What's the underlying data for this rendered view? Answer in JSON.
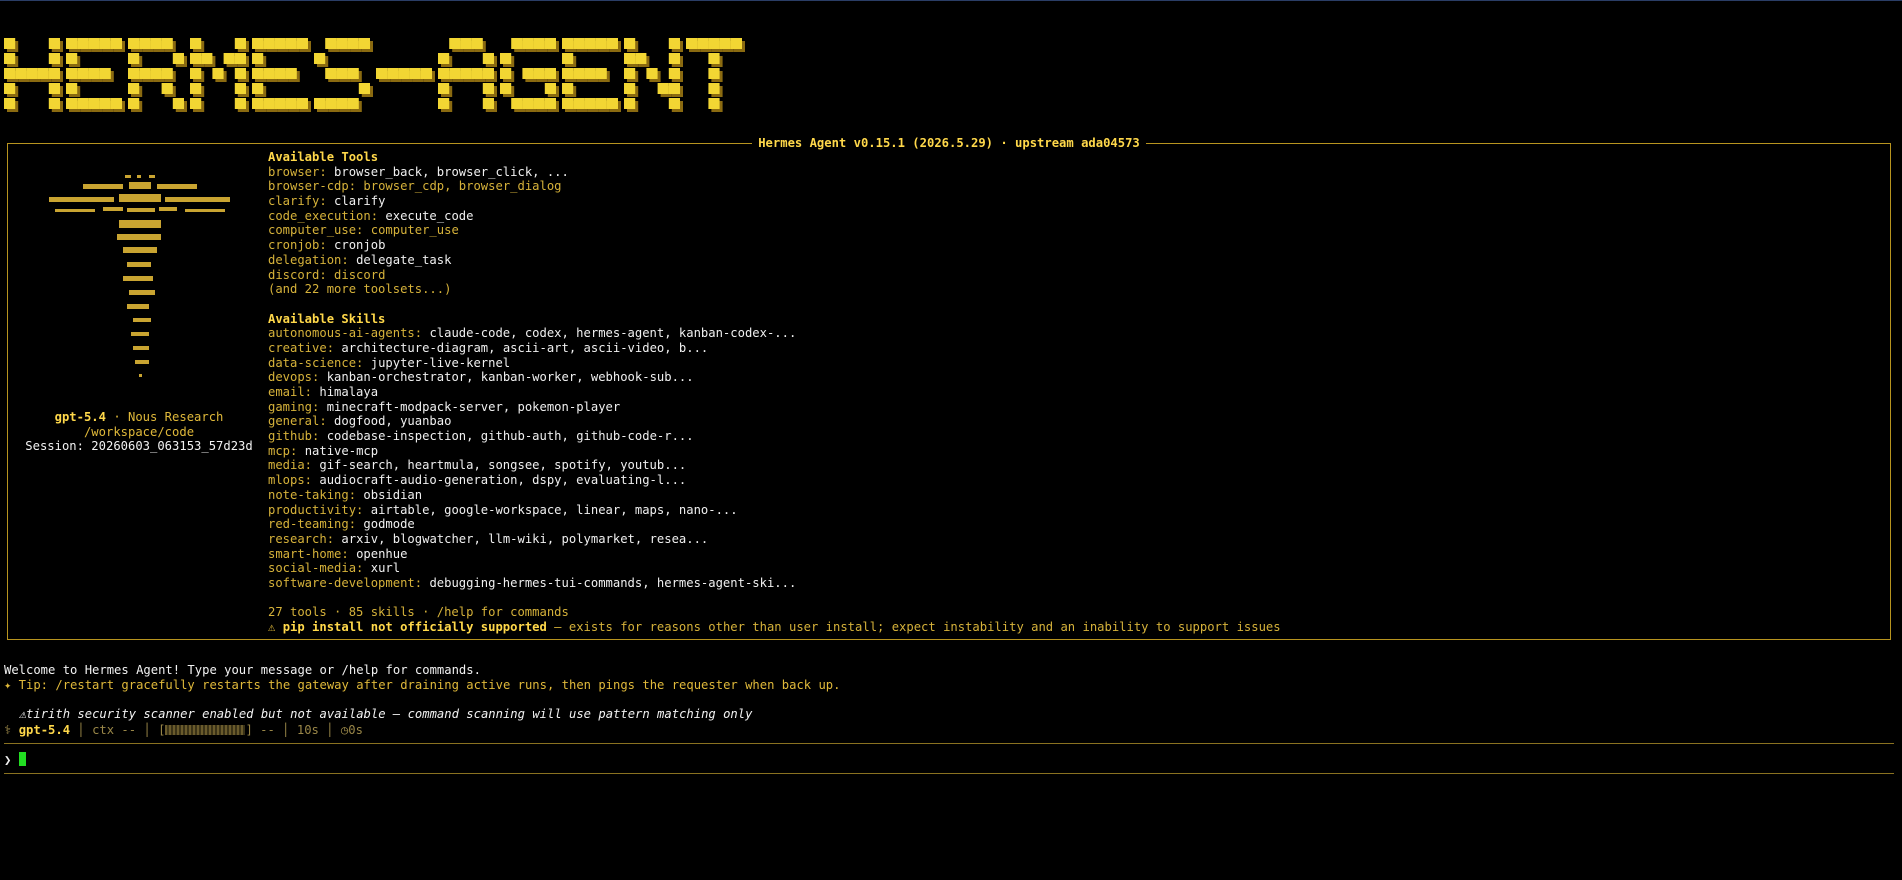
{
  "logo_text": "HERMES-AGENT",
  "banner": {
    "title": "Hermes Agent v0.15.1 (2026.5.29) · upstream ada04573",
    "model": "gpt-5.4",
    "separator": " · ",
    "provider": "Nous Research",
    "cwd": "/workspace/code",
    "session": "Session: 20260603_063153_57d23d"
  },
  "tools": {
    "heading": "Available Tools",
    "items": [
      {
        "key": "browser:",
        "value": "browser_back, browser_click, ..."
      },
      {
        "key": "browser-cdp:",
        "value": "browser_cdp, browser_dialog"
      },
      {
        "key": "clarify:",
        "value": "clarify"
      },
      {
        "key": "code_execution:",
        "value": "execute_code"
      },
      {
        "key": "computer_use:",
        "value": "computer_use"
      },
      {
        "key": "cronjob:",
        "value": "cronjob"
      },
      {
        "key": "delegation:",
        "value": "delegate_task"
      },
      {
        "key": "discord:",
        "value": "discord"
      }
    ],
    "more": "(and 22 more toolsets...)"
  },
  "skills": {
    "heading": "Available Skills",
    "items": [
      {
        "key": "autonomous-ai-agents:",
        "value": "claude-code, codex, hermes-agent, kanban-codex-..."
      },
      {
        "key": "creative:",
        "value": "architecture-diagram, ascii-art, ascii-video, b..."
      },
      {
        "key": "data-science:",
        "value": "jupyter-live-kernel"
      },
      {
        "key": "devops:",
        "value": "kanban-orchestrator, kanban-worker, webhook-sub..."
      },
      {
        "key": "email:",
        "value": "himalaya"
      },
      {
        "key": "gaming:",
        "value": "minecraft-modpack-server, pokemon-player"
      },
      {
        "key": "general:",
        "value": "dogfood, yuanbao"
      },
      {
        "key": "github:",
        "value": "codebase-inspection, github-auth, github-code-r..."
      },
      {
        "key": "mcp:",
        "value": "native-mcp"
      },
      {
        "key": "media:",
        "value": "gif-search, heartmula, songsee, spotify, youtub..."
      },
      {
        "key": "mlops:",
        "value": "audiocraft-audio-generation, dspy, evaluating-l..."
      },
      {
        "key": "note-taking:",
        "value": "obsidian"
      },
      {
        "key": "productivity:",
        "value": "airtable, google-workspace, linear, maps, nano-..."
      },
      {
        "key": "red-teaming:",
        "value": "godmode"
      },
      {
        "key": "research:",
        "value": "arxiv, blogwatcher, llm-wiki, polymarket, resea..."
      },
      {
        "key": "smart-home:",
        "value": "openhue"
      },
      {
        "key": "social-media:",
        "value": "xurl"
      },
      {
        "key": "software-development:",
        "value": "debugging-hermes-tui-commands, hermes-agent-ski..."
      }
    ]
  },
  "summary": "27 tools · 85 skills · /help for commands",
  "warning": {
    "icon": "⚠",
    "bold": "pip install not officially supported",
    "rest": " — exists for reasons other than user install; expect instability and an inability to support issues"
  },
  "welcome": "Welcome to Hermes Agent! Type your message or /help for commands.",
  "tip": "✦ Tip: /restart gracefully restarts the gateway after draining active runs, then pings the requester when back up.",
  "scanner_note": "tirith security scanner enabled but not available — command scanning will use pattern matching only",
  "scanner_icon": "⚠",
  "status": {
    "prefix": "⚕",
    "model": "gpt-5.4",
    "ctx": "ctx --",
    "bar_suffix": "--",
    "elapsed": "10s",
    "timer": "0s"
  },
  "prompt_symbol": "❯",
  "colors": {
    "accent": "#ffd84a",
    "gold": "#d6b23a",
    "border": "#b8941f",
    "cursor": "#22dd22"
  }
}
